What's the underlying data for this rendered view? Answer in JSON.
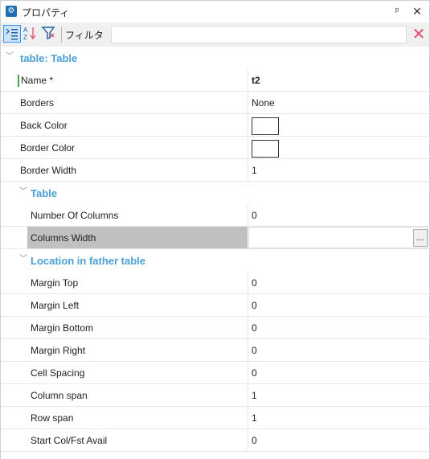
{
  "window": {
    "title": "プロパティ",
    "pin_symbol": "ᵖ",
    "close_symbol": "✕"
  },
  "toolbar": {
    "filter_label": "フィルタ",
    "filter_value": "",
    "clear_symbol": "✕"
  },
  "icons": [
    "properties-icon",
    "pin-icon",
    "close-icon",
    "categorized-icon",
    "alphabetical-sort-icon",
    "filter-icon",
    "clear-filter-icon",
    "expand-chevron-icon",
    "ellipsis-icon"
  ],
  "colors": {
    "accent": "#4b9fd5",
    "selection": "#c0c0c0",
    "required_marker": "#3aa845",
    "clear_icon": "#e05070"
  },
  "grid": {
    "category_root": "table: Table",
    "root_props": [
      {
        "name": "Name *",
        "value": "t2"
      },
      {
        "name": "Borders",
        "value": "None"
      },
      {
        "name": "Back Color",
        "value": ""
      },
      {
        "name": "Border Color",
        "value": ""
      },
      {
        "name": "Border Width",
        "value": "1"
      }
    ],
    "category_table": "Table",
    "table_props": [
      {
        "name": "Number Of Columns",
        "value": "0"
      },
      {
        "name": "Columns Width",
        "value": ""
      }
    ],
    "category_location": "Location in father table",
    "location_props": [
      {
        "name": "Margin Top",
        "value": "0"
      },
      {
        "name": "Margin Left",
        "value": "0"
      },
      {
        "name": "Margin Bottom",
        "value": "0"
      },
      {
        "name": "Margin Right",
        "value": "0"
      },
      {
        "name": "Cell Spacing",
        "value": "0"
      },
      {
        "name": "Column span",
        "value": "1"
      },
      {
        "name": "Row span",
        "value": "1"
      },
      {
        "name": "Start Col/Fst Avail",
        "value": "0"
      }
    ],
    "ellipsis_label": "..."
  }
}
